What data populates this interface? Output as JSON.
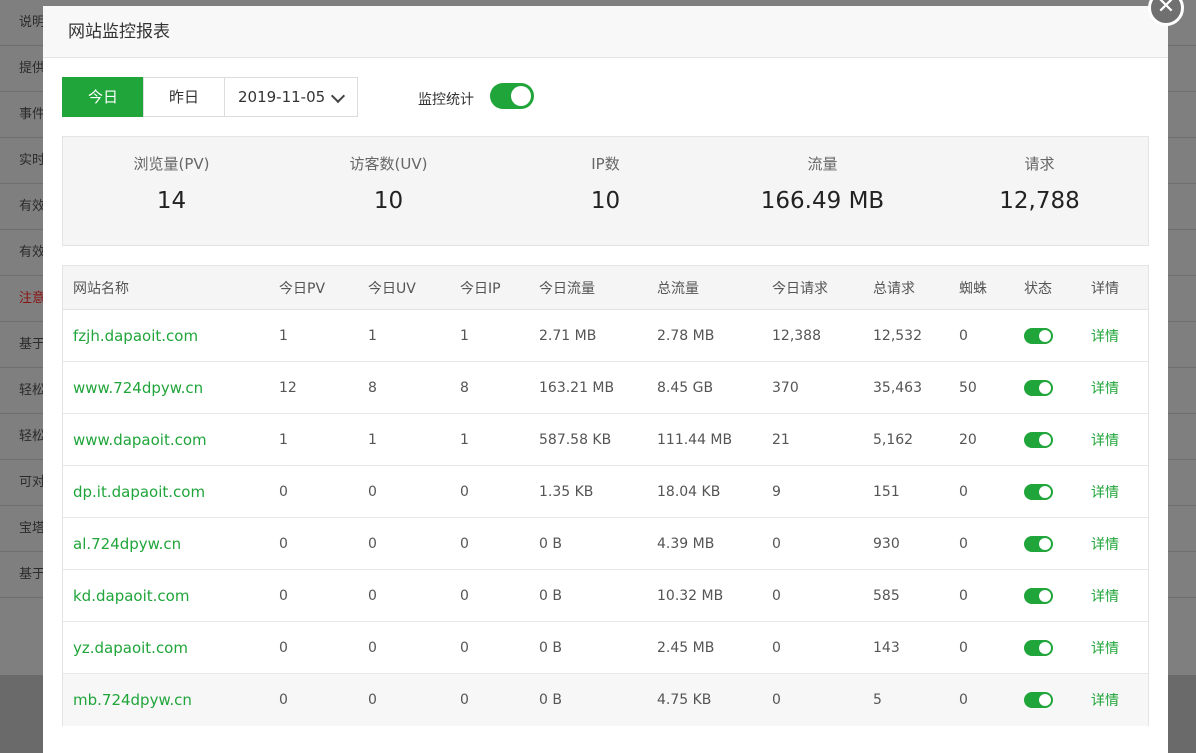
{
  "background": {
    "rows": [
      {
        "label": "说明",
        "warn": false
      },
      {
        "label": "提供",
        "warn": false
      },
      {
        "label": "事件",
        "warn": false
      },
      {
        "label": "实时",
        "warn": false
      },
      {
        "label": "有效",
        "warn": false
      },
      {
        "label": "有效",
        "warn": false
      },
      {
        "label": "注意",
        "warn": true
      },
      {
        "label": "基于",
        "warn": false
      },
      {
        "label": "轻松",
        "warn": false
      },
      {
        "label": "轻松",
        "warn": false
      },
      {
        "label": "可对",
        "warn": false
      },
      {
        "label": "宝塔",
        "warn": false
      },
      {
        "label": "基于",
        "warn": false
      }
    ]
  },
  "modal": {
    "title": "网站监控报表",
    "close_glyph": "✕"
  },
  "toolbar": {
    "today_label": "今日",
    "yesterday_label": "昨日",
    "date_value": "2019-11-05",
    "monitor_label": "监控统计",
    "monitor_enabled": true
  },
  "stats": [
    {
      "label": "浏览量(PV)",
      "value": "14"
    },
    {
      "label": "访客数(UV)",
      "value": "10"
    },
    {
      "label": "IP数",
      "value": "10"
    },
    {
      "label": "流量",
      "value": "166.49 MB"
    },
    {
      "label": "请求",
      "value": "12,788"
    }
  ],
  "table": {
    "headers": [
      "网站名称",
      "今日PV",
      "今日UV",
      "今日IP",
      "今日流量",
      "总流量",
      "今日请求",
      "总请求",
      "蜘蛛",
      "状态",
      "详情"
    ],
    "detail_label": "详情",
    "rows": [
      {
        "site": "fzjh.dapaoit.com",
        "pv": "1",
        "uv": "1",
        "ip": "1",
        "today_flow": "2.71 MB",
        "total_flow": "2.78 MB",
        "today_req": "12,388",
        "total_req": "12,532",
        "spider": "0",
        "status": true
      },
      {
        "site": "www.724dpyw.cn",
        "pv": "12",
        "uv": "8",
        "ip": "8",
        "today_flow": "163.21 MB",
        "total_flow": "8.45 GB",
        "today_req": "370",
        "total_req": "35,463",
        "spider": "50",
        "status": true
      },
      {
        "site": "www.dapaoit.com",
        "pv": "1",
        "uv": "1",
        "ip": "1",
        "today_flow": "587.58 KB",
        "total_flow": "111.44 MB",
        "today_req": "21",
        "total_req": "5,162",
        "spider": "20",
        "status": true
      },
      {
        "site": "dp.it.dapaoit.com",
        "pv": "0",
        "uv": "0",
        "ip": "0",
        "today_flow": "1.35 KB",
        "total_flow": "18.04 KB",
        "today_req": "9",
        "total_req": "151",
        "spider": "0",
        "status": true
      },
      {
        "site": "al.724dpyw.cn",
        "pv": "0",
        "uv": "0",
        "ip": "0",
        "today_flow": "0 B",
        "total_flow": "4.39 MB",
        "today_req": "0",
        "total_req": "930",
        "spider": "0",
        "status": true
      },
      {
        "site": "kd.dapaoit.com",
        "pv": "0",
        "uv": "0",
        "ip": "0",
        "today_flow": "0 B",
        "total_flow": "10.32 MB",
        "today_req": "0",
        "total_req": "585",
        "spider": "0",
        "status": true
      },
      {
        "site": "yz.dapaoit.com",
        "pv": "0",
        "uv": "0",
        "ip": "0",
        "today_flow": "0 B",
        "total_flow": "2.45 MB",
        "today_req": "0",
        "total_req": "143",
        "spider": "0",
        "status": true
      },
      {
        "site": "mb.724dpyw.cn",
        "pv": "0",
        "uv": "0",
        "ip": "0",
        "today_flow": "0 B",
        "total_flow": "4.75 KB",
        "today_req": "0",
        "total_req": "5",
        "spider": "0",
        "status": true
      }
    ]
  },
  "colors": {
    "accent": "#20a53a",
    "overlay": "#7f7f7f"
  }
}
